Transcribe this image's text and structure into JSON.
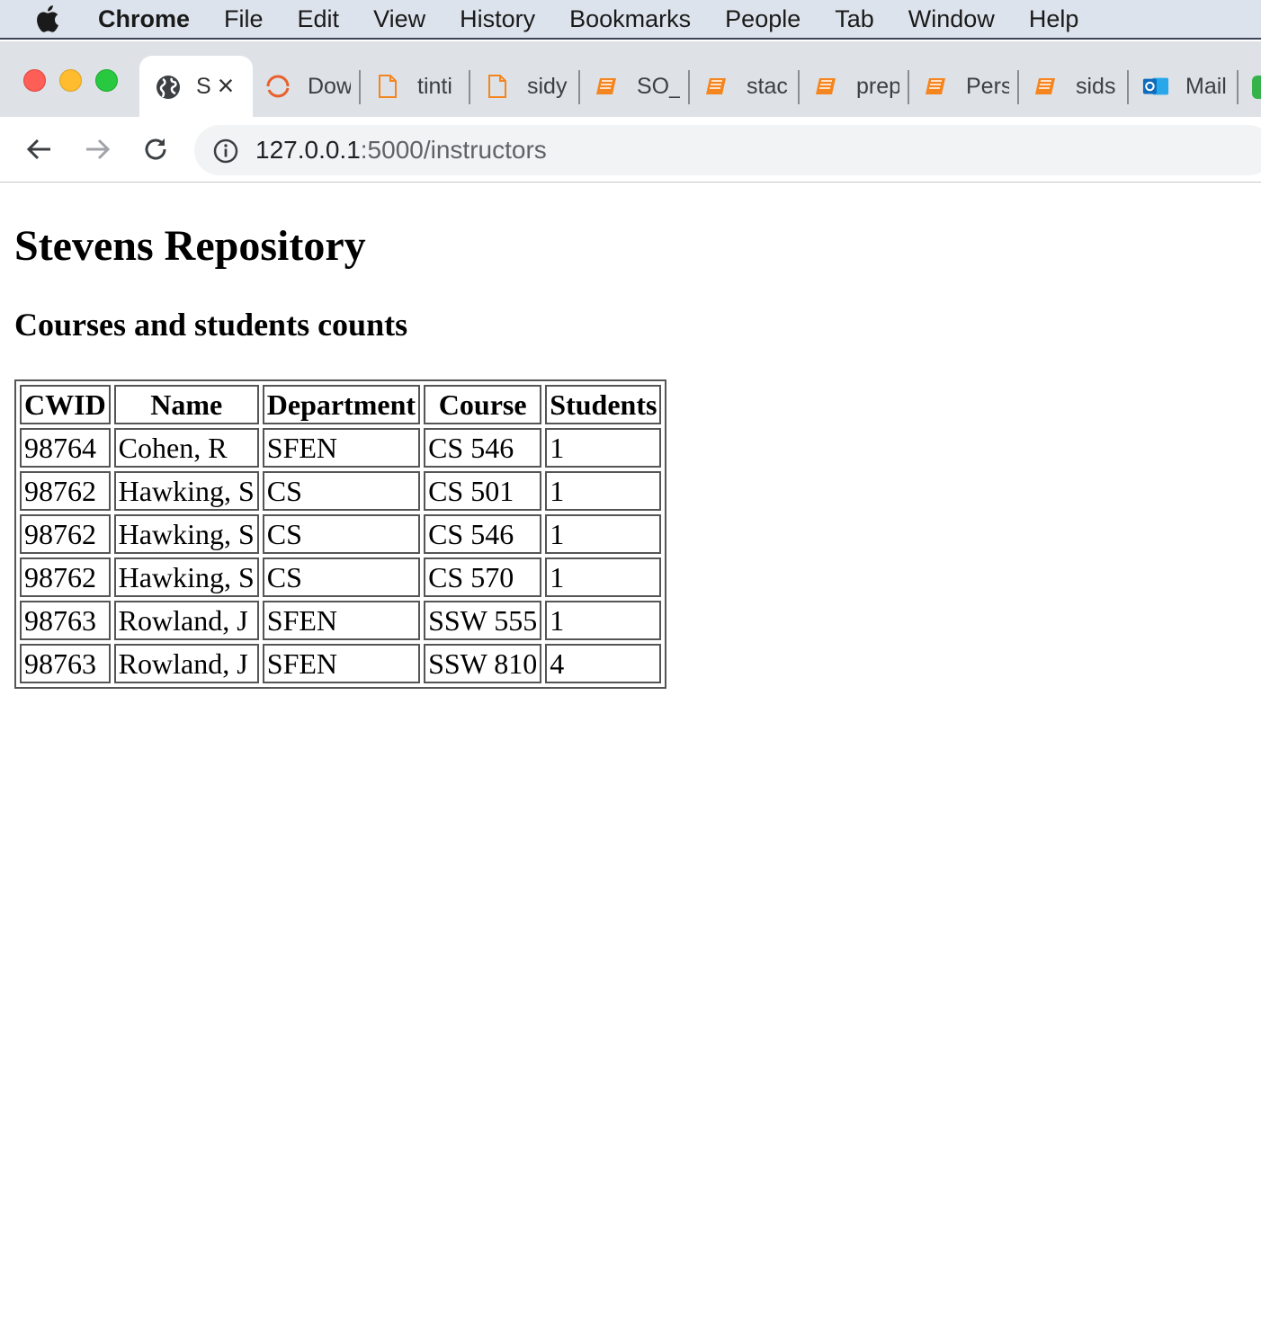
{
  "menubar": {
    "app": "Chrome",
    "items": [
      "File",
      "Edit",
      "View",
      "History",
      "Bookmarks",
      "People",
      "Tab",
      "Window",
      "Help"
    ]
  },
  "tabs": {
    "active": {
      "label": "S",
      "close": "×",
      "icon": "globe-icon"
    },
    "others": [
      {
        "label": "Dow",
        "icon": "loading-icon"
      },
      {
        "label": "tinti",
        "icon": "document-icon"
      },
      {
        "label": "sidy",
        "icon": "document-icon"
      },
      {
        "label": "SO_",
        "icon": "book-icon"
      },
      {
        "label": "stac",
        "icon": "book-icon"
      },
      {
        "label": "prep",
        "icon": "book-icon"
      },
      {
        "label": "Pers",
        "icon": "book-icon"
      },
      {
        "label": "sids",
        "icon": "book-icon"
      },
      {
        "label": "Mail",
        "icon": "outlook-icon"
      }
    ]
  },
  "address": {
    "host": "127.0.0.1",
    "path": ":5000/instructors"
  },
  "page": {
    "title": "Stevens Repository",
    "subtitle": "Courses and students counts",
    "table": {
      "headers": [
        "CWID",
        "Name",
        "Department",
        "Course",
        "Students"
      ],
      "rows": [
        [
          "98764",
          "Cohen, R",
          "SFEN",
          "CS 546",
          "1"
        ],
        [
          "98762",
          "Hawking, S",
          "CS",
          "CS 501",
          "1"
        ],
        [
          "98762",
          "Hawking, S",
          "CS",
          "CS 546",
          "1"
        ],
        [
          "98762",
          "Hawking, S",
          "CS",
          "CS 570",
          "1"
        ],
        [
          "98763",
          "Rowland, J",
          "SFEN",
          "SSW 555",
          "1"
        ],
        [
          "98763",
          "Rowland, J",
          "SFEN",
          "SSW 810",
          "4"
        ]
      ]
    }
  },
  "colors": {
    "menubar_bg": "#dde3ec",
    "tabstrip_bg": "#dee1e6",
    "omnibox_bg": "#f1f3f4",
    "book_icon": "#f5851f",
    "outlook_blue": "#0f6cbd"
  }
}
